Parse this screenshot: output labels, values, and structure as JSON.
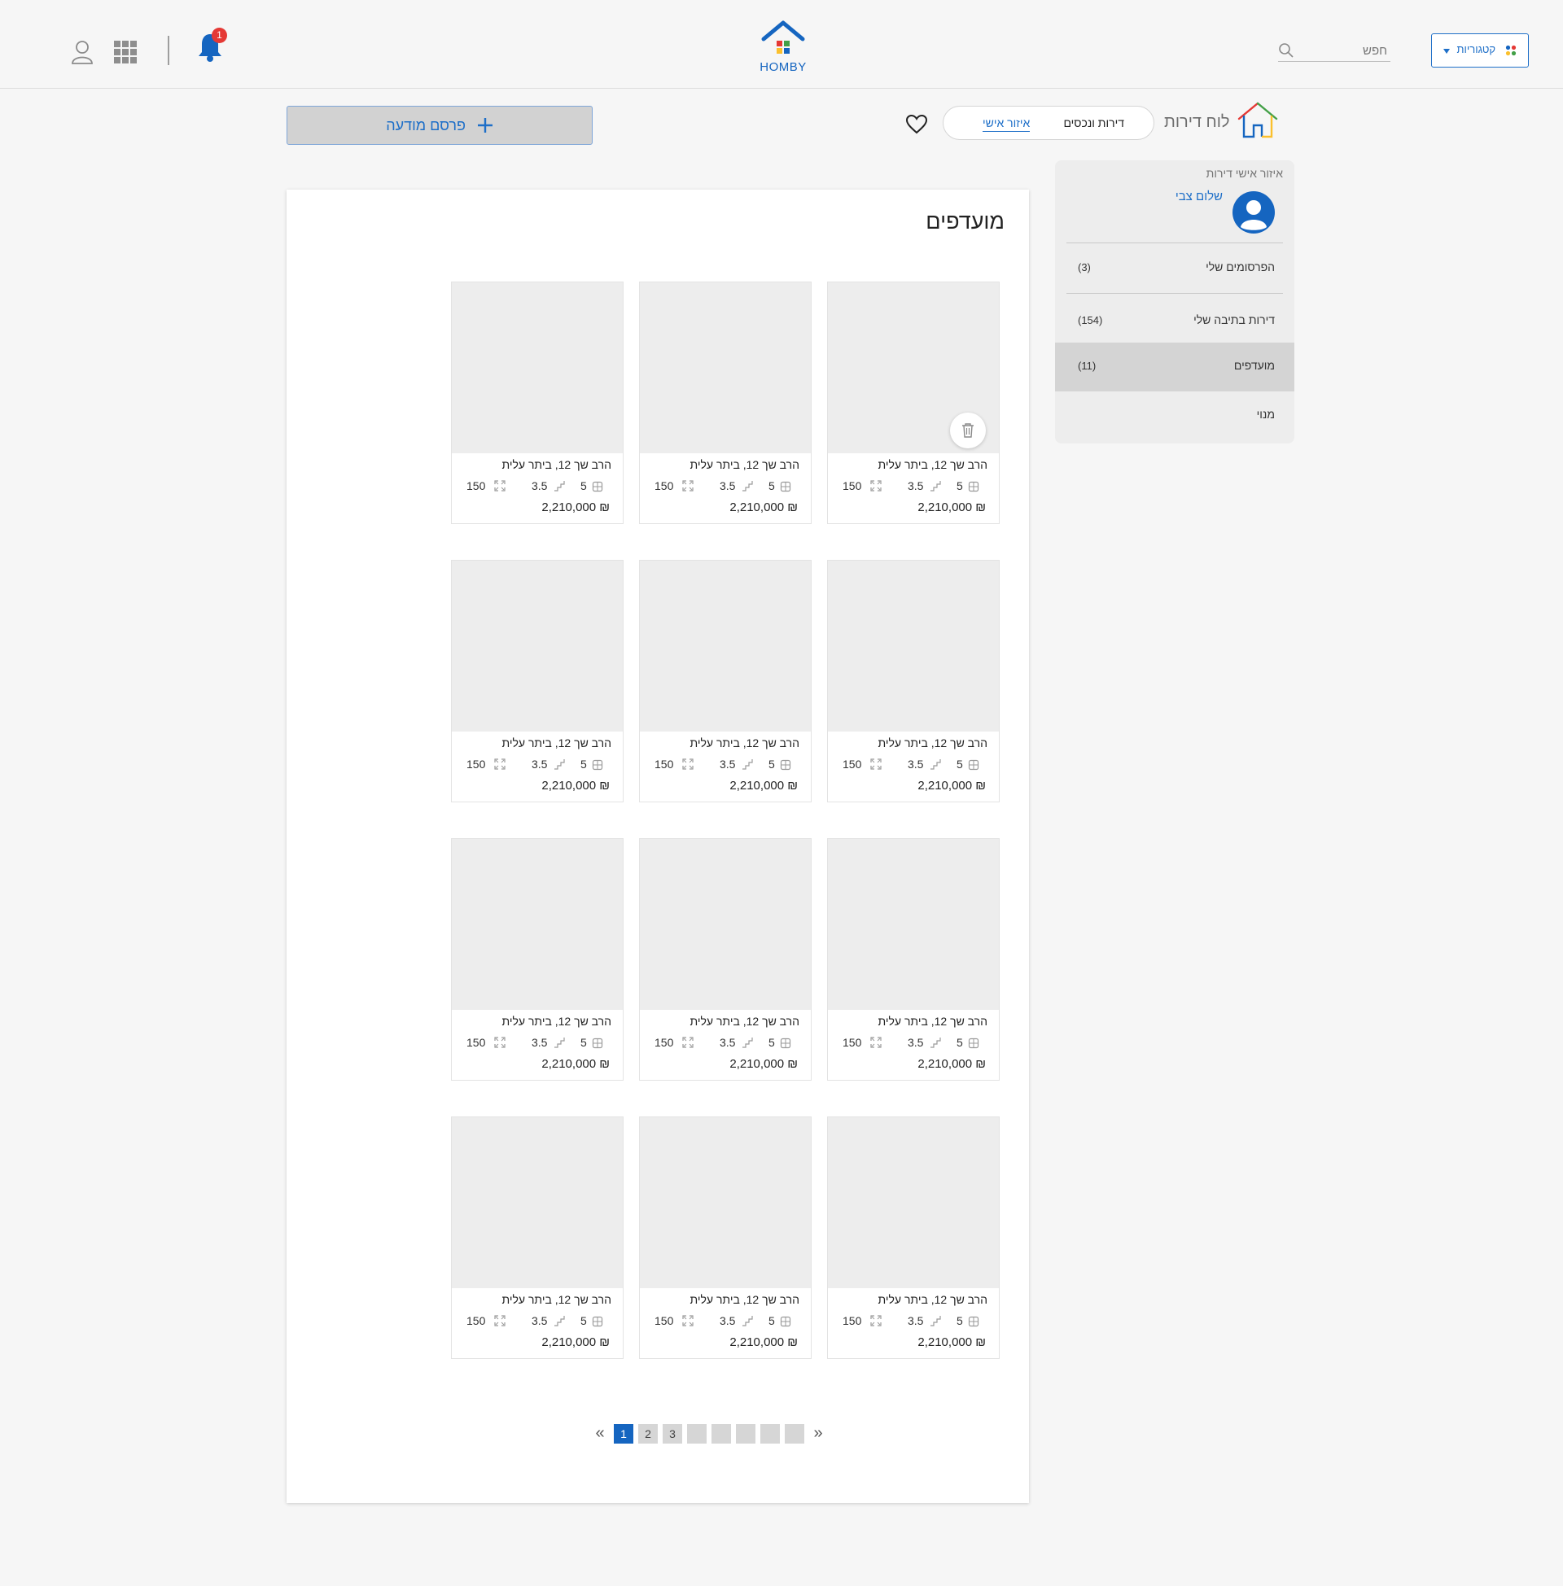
{
  "header": {
    "logo_text": "HOMBY",
    "notifications_count": "1",
    "search_placeholder": "חפש",
    "categories_label": "קטגוריות"
  },
  "topbar": {
    "post_ad_label": "פרסם מודעה",
    "tabs": [
      "דירות ונכסים",
      "איזור אישי"
    ],
    "active_tab": "איזור אישי",
    "board_title": "לוח דירות"
  },
  "sidebar": {
    "title": "איזור אישי דירות",
    "user_name": "שלום צבי",
    "items": [
      {
        "label": "הפרסומים שלי",
        "count": "(3)"
      },
      {
        "label": "דירות בתיבה שלי",
        "count": "(154)"
      },
      {
        "label": "מועדפים",
        "count": "(11)"
      },
      {
        "label": "מנוי",
        "count": ""
      }
    ]
  },
  "main": {
    "title": "מועדפים",
    "listings": [
      {
        "address": "הרב שך 12, ביתר עלית",
        "rooms": "5",
        "floor": "3.5",
        "size": "150",
        "price": "2,210,000 ₪"
      },
      {
        "address": "הרב שך 12, ביתר עלית",
        "rooms": "5",
        "floor": "3.5",
        "size": "150",
        "price": "2,210,000 ₪"
      },
      {
        "address": "הרב שך 12, ביתר עלית",
        "rooms": "5",
        "floor": "3.5",
        "size": "150",
        "price": "2,210,000 ₪"
      },
      {
        "address": "הרב שך 12, ביתר עלית",
        "rooms": "5",
        "floor": "3.5",
        "size": "150",
        "price": "2,210,000 ₪"
      },
      {
        "address": "הרב שך 12, ביתר עלית",
        "rooms": "5",
        "floor": "3.5",
        "size": "150",
        "price": "2,210,000 ₪"
      },
      {
        "address": "הרב שך 12, ביתר עלית",
        "rooms": "5",
        "floor": "3.5",
        "size": "150",
        "price": "2,210,000 ₪"
      },
      {
        "address": "הרב שך 12, ביתר עלית",
        "rooms": "5",
        "floor": "3.5",
        "size": "150",
        "price": "2,210,000 ₪"
      },
      {
        "address": "הרב שך 12, ביתר עלית",
        "rooms": "5",
        "floor": "3.5",
        "size": "150",
        "price": "2,210,000 ₪"
      },
      {
        "address": "הרב שך 12, ביתר עלית",
        "rooms": "5",
        "floor": "3.5",
        "size": "150",
        "price": "2,210,000 ₪"
      },
      {
        "address": "הרב שך 12, ביתר עלית",
        "rooms": "5",
        "floor": "3.5",
        "size": "150",
        "price": "2,210,000 ₪"
      },
      {
        "address": "הרב שך 12, ביתר עלית",
        "rooms": "5",
        "floor": "3.5",
        "size": "150",
        "price": "2,210,000 ₪"
      },
      {
        "address": "הרב שך 12, ביתר עלית",
        "rooms": "5",
        "floor": "3.5",
        "size": "150",
        "price": "2,210,000 ₪"
      }
    ]
  },
  "pagination": {
    "pages": [
      "1",
      "2",
      "3",
      "",
      "",
      "",
      "",
      ""
    ],
    "active_page": "1",
    "prev_label": "«",
    "next_label": "»"
  },
  "colors": {
    "accent": "#1e6fc8",
    "badge": "#e53935",
    "card_image": "#ededed"
  }
}
